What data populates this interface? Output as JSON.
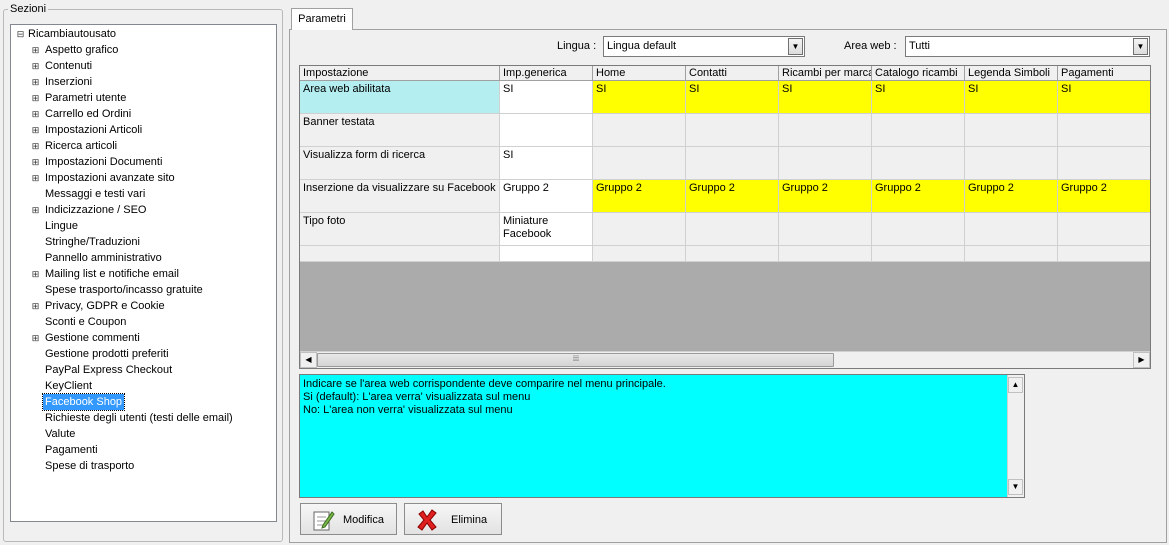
{
  "sections": {
    "legend": "Sezioni",
    "root": "Ricambiautousato",
    "items": [
      {
        "label": "Aspetto grafico",
        "expandable": true
      },
      {
        "label": "Contenuti",
        "expandable": true
      },
      {
        "label": "Inserzioni",
        "expandable": true
      },
      {
        "label": "Parametri utente",
        "expandable": true
      },
      {
        "label": "Carrello ed Ordini",
        "expandable": true
      },
      {
        "label": "Impostazioni Articoli",
        "expandable": true
      },
      {
        "label": "Ricerca articoli",
        "expandable": true
      },
      {
        "label": "Impostazioni Documenti",
        "expandable": true
      },
      {
        "label": "Impostazioni avanzate sito",
        "expandable": true
      },
      {
        "label": "Messaggi e testi vari",
        "expandable": false
      },
      {
        "label": "Indicizzazione / SEO",
        "expandable": true
      },
      {
        "label": "Lingue",
        "expandable": false
      },
      {
        "label": "Stringhe/Traduzioni",
        "expandable": false
      },
      {
        "label": "Pannello amministrativo",
        "expandable": false
      },
      {
        "label": "Mailing list e notifiche email",
        "expandable": true
      },
      {
        "label": "Spese trasporto/incasso gratuite",
        "expandable": false
      },
      {
        "label": "Privacy, GDPR e Cookie",
        "expandable": true
      },
      {
        "label": "Sconti e Coupon",
        "expandable": false
      },
      {
        "label": "Gestione commenti",
        "expandable": true
      },
      {
        "label": "Gestione prodotti preferiti",
        "expandable": false
      },
      {
        "label": "PayPal Express Checkout",
        "expandable": false
      },
      {
        "label": "KeyClient",
        "expandable": false
      },
      {
        "label": "Facebook Shop",
        "expandable": false,
        "selected": true
      },
      {
        "label": "Richieste degli utenti (testi delle email)",
        "expandable": false
      },
      {
        "label": "Valute",
        "expandable": false
      },
      {
        "label": "Pagamenti",
        "expandable": false
      },
      {
        "label": "Spese di trasporto",
        "expandable": false
      }
    ]
  },
  "tab": {
    "label": "Parametri"
  },
  "filters": {
    "lingua_label": "Lingua :",
    "lingua_value": "Lingua default",
    "area_label": "Area web :",
    "area_value": "Tutti"
  },
  "grid": {
    "columns": [
      "Impostazione",
      "Imp.generica",
      "Home",
      "Contatti",
      "Ricambi per marca",
      "Catalogo ricambi",
      "Legenda Simboli",
      "Pagamenti"
    ],
    "rows": [
      {
        "cells": [
          "Area web abilitata",
          "SI",
          "SI",
          "SI",
          "SI",
          "SI",
          "SI",
          "SI"
        ],
        "style": "yellow",
        "selected": true
      },
      {
        "cells": [
          "Banner testata",
          "",
          "",
          "",
          "",
          "",
          "",
          ""
        ],
        "style": "plain"
      },
      {
        "cells": [
          "Visualizza form di ricerca",
          "SI",
          "",
          "",
          "",
          "",
          "",
          ""
        ],
        "style": "plain"
      },
      {
        "cells": [
          "Inserzione da visualizzare su Facebook",
          "Gruppo 2",
          "Gruppo 2",
          "Gruppo 2",
          "Gruppo 2",
          "Gruppo 2",
          "Gruppo 2",
          "Gruppo 2"
        ],
        "style": "yellow"
      },
      {
        "cells": [
          "Tipo foto",
          "Miniature Facebook",
          "",
          "",
          "",
          "",
          "",
          ""
        ],
        "style": "plain"
      },
      {
        "cells": [
          "",
          "",
          "",
          "",
          "",
          "",
          "",
          ""
        ],
        "style": "plain"
      }
    ]
  },
  "description": {
    "lines": [
      "Indicare se l'area web corrispondente deve comparire nel menu principale.",
      "Si (default): L'area verra' visualizzata sul menu",
      "No: L'area non verra' visualizzata sul menu"
    ]
  },
  "buttons": {
    "modifica": "Modifica",
    "elimina": "Elimina"
  },
  "colors": {
    "highlight": "#ffff00",
    "selected_cell": "#b4eef0",
    "description_bg": "#00ffff",
    "tree_selection": "#3399ff"
  }
}
